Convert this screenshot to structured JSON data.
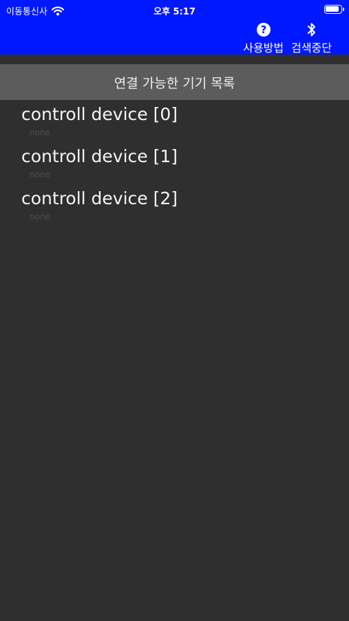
{
  "status_bar": {
    "carrier": "이동통신사",
    "time": "오후 5:17",
    "battery_level": 0.95
  },
  "toolbar": {
    "help_label": "사용방법",
    "stop_scan_label": "검색중단"
  },
  "section": {
    "title": "연결 가능한 기기 목록"
  },
  "devices": [
    {
      "name": "controll device [0]",
      "status": "none"
    },
    {
      "name": "controll device [1]",
      "status": "none"
    },
    {
      "name": "controll device [2]",
      "status": "none"
    }
  ],
  "colors": {
    "nav_background": "#0018ff",
    "section_header_background": "#5c5c5c",
    "page_background": "#2f2f2f"
  }
}
